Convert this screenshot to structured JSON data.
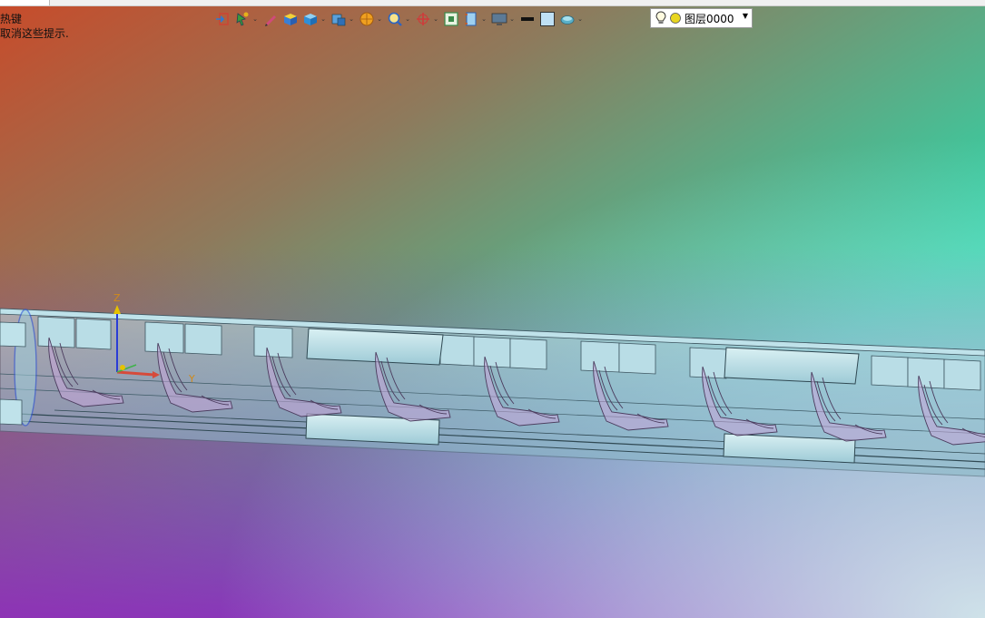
{
  "hints": {
    "line1": "热键",
    "line2": "取消这些提示."
  },
  "toolbar": {
    "items": [
      {
        "name": "exit-sketch-icon",
        "dropdown": false
      },
      {
        "name": "select-filter-icon",
        "dropdown": true
      },
      {
        "name": "pen-icon",
        "dropdown": false
      },
      {
        "name": "shaded-box-icon",
        "dropdown": false
      },
      {
        "name": "view-cube-icon",
        "dropdown": true
      },
      {
        "name": "display-cube-icon",
        "dropdown": true
      },
      {
        "name": "sphere-render-icon",
        "dropdown": true
      },
      {
        "name": "zoom-icon",
        "dropdown": true
      },
      {
        "name": "rotate-axis-icon",
        "dropdown": true
      },
      {
        "name": "fit-view-icon",
        "dropdown": false
      },
      {
        "name": "section-view-icon",
        "dropdown": true
      },
      {
        "name": "monitor-icon",
        "dropdown": true
      },
      {
        "name": "line-width-icon",
        "dropdown": false
      },
      {
        "name": "color-swatch-icon",
        "dropdown": false
      },
      {
        "name": "material-icon",
        "dropdown": true
      }
    ]
  },
  "layer": {
    "label": "图层0000"
  },
  "axes": {
    "z": "Z",
    "y": "Y"
  },
  "colors": {
    "accent_blue": "#3b6fd6",
    "tube_fill": "#a9d3de",
    "seat_purple": "#c7a6d8"
  }
}
